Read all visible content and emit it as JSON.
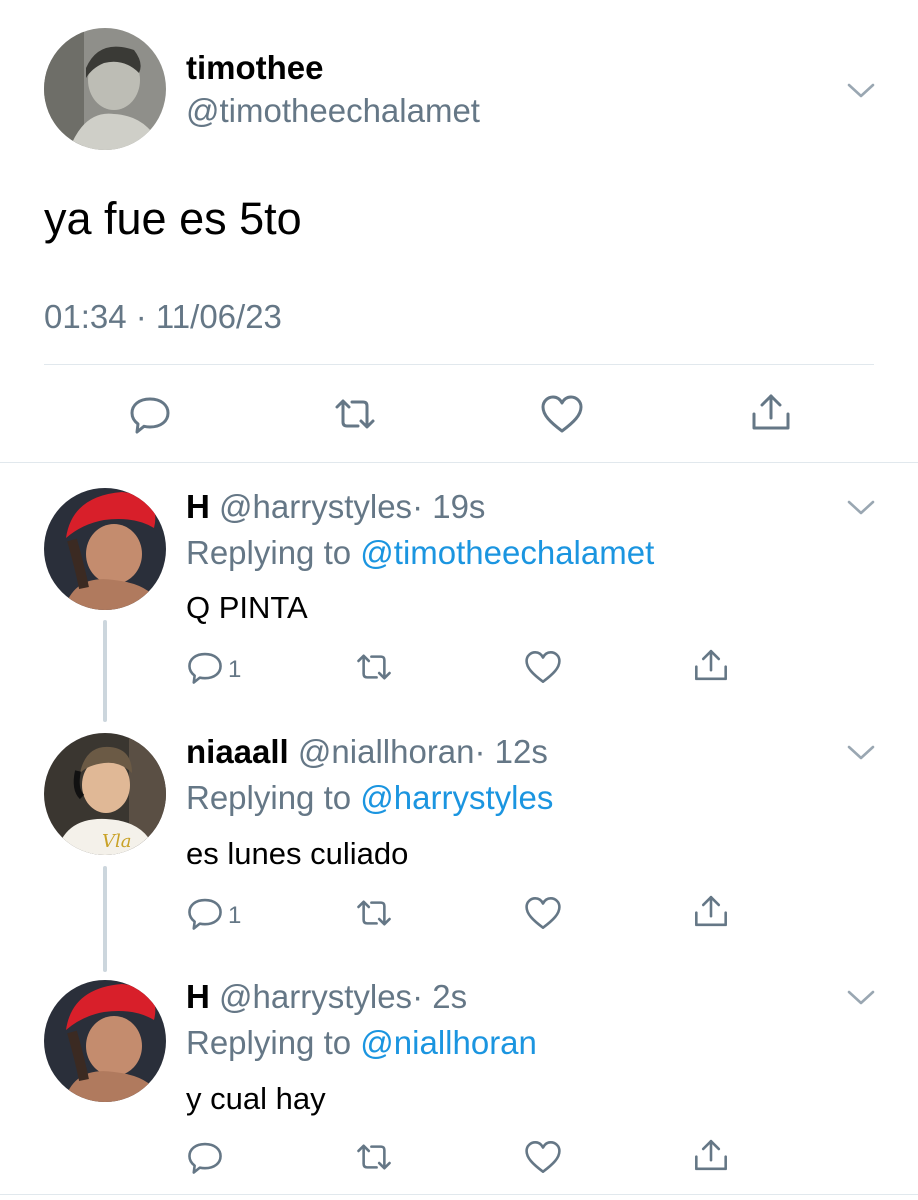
{
  "main_tweet": {
    "display_name": "timothee",
    "handle": "@timotheechalamet",
    "text": "ya fue es 5to",
    "timestamp": "01:34 · 11/06/23",
    "actions": [
      "reply",
      "retweet",
      "like",
      "share"
    ]
  },
  "replies": [
    {
      "display_name": "H",
      "handle": "@harrystyles",
      "age": "· 19s",
      "replying_prefix": "Replying to",
      "replying_to": "@timotheechalamet",
      "text": "Q PINTA",
      "reply_count": "1"
    },
    {
      "display_name": "niaaall",
      "handle": "@niallhoran",
      "age": "· 12s",
      "replying_prefix": "Replying to",
      "replying_to": "@harrystyles",
      "text": "es lunes culiado",
      "reply_count": "1"
    },
    {
      "display_name": "H",
      "handle": "@harrystyles",
      "age": "· 2s",
      "replying_prefix": "Replying to",
      "replying_to": "@niallhoran",
      "text": "y cual hay",
      "reply_count": ""
    }
  ],
  "colors": {
    "secondary_text": "#657786",
    "link": "#1b95e0",
    "divider": "#e1e8ed",
    "thread_line": "#ccd6dd"
  }
}
